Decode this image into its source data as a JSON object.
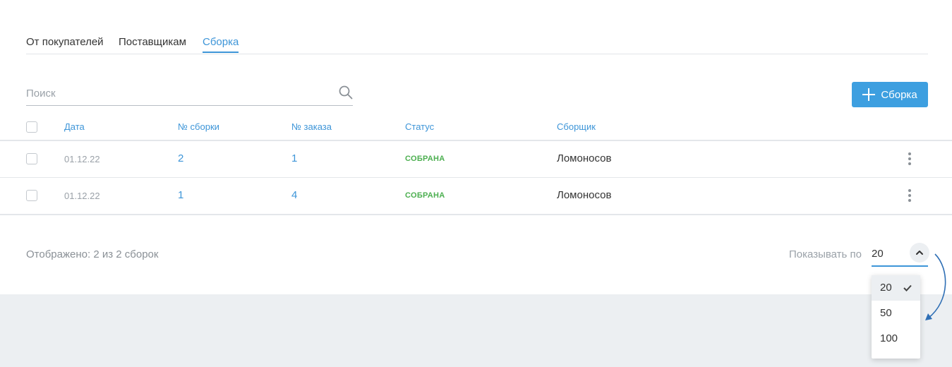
{
  "tabs": [
    {
      "label": "От покупателей"
    },
    {
      "label": "Поставщикам"
    },
    {
      "label": "Сборка"
    }
  ],
  "search": {
    "placeholder": "Поиск",
    "value": "",
    "icon": "search-icon"
  },
  "add_button": {
    "label": "Сборка",
    "icon": "plus-icon"
  },
  "table": {
    "columns": [
      "Дата",
      "№ сборки",
      "№ заказа",
      "Статус",
      "Сборщик"
    ],
    "rows": [
      {
        "date": "01.12.22",
        "assembly_no": "2",
        "order_no": "1",
        "status": "СОБРАНА",
        "assembler": "Ломоносов"
      },
      {
        "date": "01.12.22",
        "assembly_no": "1",
        "order_no": "4",
        "status": "СОБРАНА",
        "assembler": "Ломоносов"
      }
    ]
  },
  "footer": {
    "summary": "Отображено: 2 из 2 сборок",
    "per_page_label": "Показывать по",
    "per_page_value": "20",
    "per_page_options": [
      "20",
      "50",
      "100"
    ]
  },
  "colors": {
    "accent": "#3d95d8",
    "button": "#3d9fe0",
    "status_done": "#4caf50",
    "muted": "#9aa1a8",
    "footer_bg": "#eceff2"
  }
}
